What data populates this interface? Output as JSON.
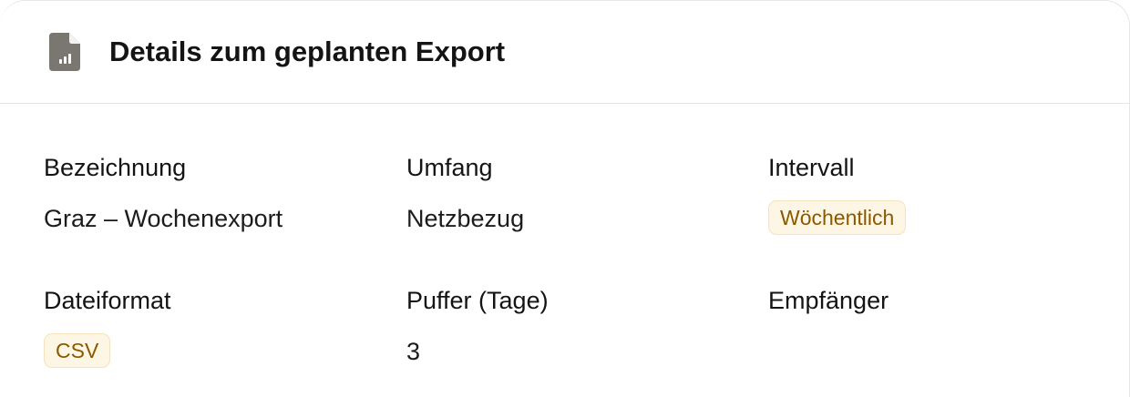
{
  "header": {
    "title": "Details zum geplanten Export",
    "icon": "file-chart-icon"
  },
  "fields": {
    "bezeichnung": {
      "label": "Bezeichnung",
      "value": "Graz – Wochenexport"
    },
    "umfang": {
      "label": "Umfang",
      "value": "Netzbezug"
    },
    "intervall": {
      "label": "Intervall",
      "value": "Wöchentlich"
    },
    "dateiformat": {
      "label": "Dateiformat",
      "value": "CSV"
    },
    "puffer": {
      "label": "Puffer (Tage)",
      "value": "3"
    },
    "empfaenger": {
      "label": "Empfänger",
      "value": ""
    }
  },
  "colors": {
    "badge_bg": "#fdf6e4",
    "badge_border": "#f3e3bf",
    "badge_text": "#8a5a00",
    "icon": "#7a7770"
  }
}
